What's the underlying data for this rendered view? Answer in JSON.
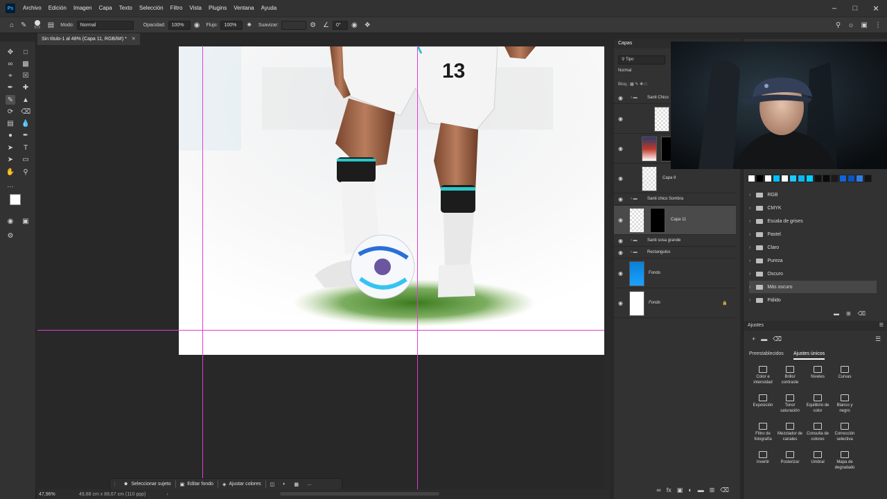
{
  "menu": [
    "Archivo",
    "Edición",
    "Imagen",
    "Capa",
    "Texto",
    "Selección",
    "Filtro",
    "Vista",
    "Plugins",
    "Ventana",
    "Ayuda"
  ],
  "options": {
    "brush_size": "573",
    "mode_label": "Modo:",
    "mode_value": "Normal",
    "opacity_label": "Opacidad:",
    "opacity_value": "100%",
    "flow_label": "Flujo:",
    "flow_value": "100%",
    "smooth_label": "Suavizar:",
    "angle_value": "0°"
  },
  "document": {
    "tab_title": "Sin título-1 al 48% (Capa 11, RGB/8#) *",
    "jersey_number": "13"
  },
  "layers_panel": {
    "title": "Capas",
    "filter_value": "Tipo",
    "blend_mode": "Normal",
    "lock_label": "Bloq.:",
    "layers": [
      {
        "name": "Santi Chico",
        "type": "group"
      },
      {
        "name": "",
        "type": "layer"
      },
      {
        "name": "",
        "type": "layer"
      },
      {
        "name": "Capa 9",
        "type": "layer"
      },
      {
        "name": "Santi chico Sombra",
        "type": "group"
      },
      {
        "name": "Capa 11",
        "type": "layer"
      },
      {
        "name": "Santi sosa grande",
        "type": "group"
      },
      {
        "name": "Rectangulos",
        "type": "group"
      },
      {
        "name": "Fondo",
        "type": "layer"
      },
      {
        "name": "Fondo",
        "type": "background"
      }
    ]
  },
  "swatches": {
    "colors": [
      "#ffffff",
      "#000000",
      "#ffffff",
      "#00bfff",
      "#ffffff",
      "#1ec8ff",
      "#10b4f0",
      "#00d0ff",
      "#111111",
      "#0a0a0a",
      "#1a1a1a",
      "#1064d8",
      "#0b55c0",
      "#2c7ee8",
      "#141414"
    ],
    "folders": [
      "RGB",
      "CMYK",
      "Escala de grises",
      "Pastel",
      "Claro",
      "Pureza",
      "Oscuro",
      "Más oscuro",
      "Pálido"
    ]
  },
  "adjustments": {
    "title": "Ajustes",
    "tabs": [
      "Preestablecidos",
      "Ajustes únicos"
    ],
    "items": [
      "Color e intensidad",
      "Brillo/ contraste",
      "Niveles",
      "Curvas",
      "Exposición",
      "Tono/ saturación",
      "Equilibrio de color",
      "Blanco y negro",
      "Filtro de fotografía",
      "Mezclador de canales",
      "Consulta de colores",
      "Corrección selectiva",
      "Invertir",
      "Posterizar",
      "Umbral",
      "Mapa de degradado"
    ]
  },
  "context_bar": {
    "select_subject": "Seleccionar sujeto",
    "edit_background": "Editar fondo",
    "adjust_colors": "Ajustar colores"
  },
  "status": {
    "zoom": "47,96%",
    "doc_size": "49,88 cm x 88,67 cm (110 ppp)"
  }
}
